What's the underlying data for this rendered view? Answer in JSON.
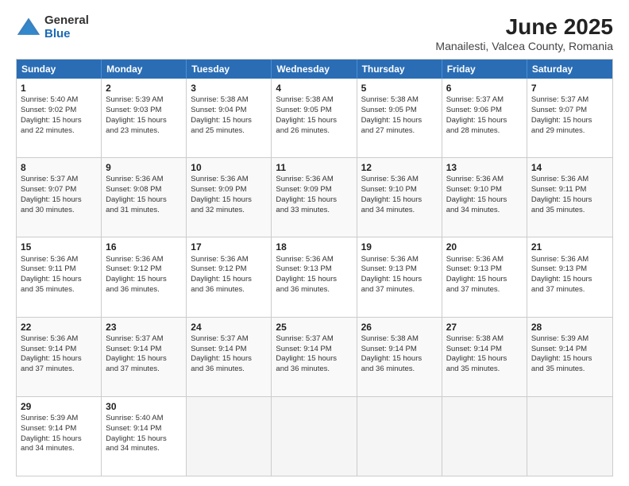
{
  "logo": {
    "general": "General",
    "blue": "Blue"
  },
  "title": "June 2025",
  "subtitle": "Manailesti, Valcea County, Romania",
  "header_days": [
    "Sunday",
    "Monday",
    "Tuesday",
    "Wednesday",
    "Thursday",
    "Friday",
    "Saturday"
  ],
  "weeks": [
    [
      {
        "day": "1",
        "lines": [
          "Sunrise: 5:40 AM",
          "Sunset: 9:02 PM",
          "Daylight: 15 hours",
          "and 22 minutes."
        ]
      },
      {
        "day": "2",
        "lines": [
          "Sunrise: 5:39 AM",
          "Sunset: 9:03 PM",
          "Daylight: 15 hours",
          "and 23 minutes."
        ]
      },
      {
        "day": "3",
        "lines": [
          "Sunrise: 5:38 AM",
          "Sunset: 9:04 PM",
          "Daylight: 15 hours",
          "and 25 minutes."
        ]
      },
      {
        "day": "4",
        "lines": [
          "Sunrise: 5:38 AM",
          "Sunset: 9:05 PM",
          "Daylight: 15 hours",
          "and 26 minutes."
        ]
      },
      {
        "day": "5",
        "lines": [
          "Sunrise: 5:38 AM",
          "Sunset: 9:05 PM",
          "Daylight: 15 hours",
          "and 27 minutes."
        ]
      },
      {
        "day": "6",
        "lines": [
          "Sunrise: 5:37 AM",
          "Sunset: 9:06 PM",
          "Daylight: 15 hours",
          "and 28 minutes."
        ]
      },
      {
        "day": "7",
        "lines": [
          "Sunrise: 5:37 AM",
          "Sunset: 9:07 PM",
          "Daylight: 15 hours",
          "and 29 minutes."
        ]
      }
    ],
    [
      {
        "day": "8",
        "lines": [
          "Sunrise: 5:37 AM",
          "Sunset: 9:07 PM",
          "Daylight: 15 hours",
          "and 30 minutes."
        ]
      },
      {
        "day": "9",
        "lines": [
          "Sunrise: 5:36 AM",
          "Sunset: 9:08 PM",
          "Daylight: 15 hours",
          "and 31 minutes."
        ]
      },
      {
        "day": "10",
        "lines": [
          "Sunrise: 5:36 AM",
          "Sunset: 9:09 PM",
          "Daylight: 15 hours",
          "and 32 minutes."
        ]
      },
      {
        "day": "11",
        "lines": [
          "Sunrise: 5:36 AM",
          "Sunset: 9:09 PM",
          "Daylight: 15 hours",
          "and 33 minutes."
        ]
      },
      {
        "day": "12",
        "lines": [
          "Sunrise: 5:36 AM",
          "Sunset: 9:10 PM",
          "Daylight: 15 hours",
          "and 34 minutes."
        ]
      },
      {
        "day": "13",
        "lines": [
          "Sunrise: 5:36 AM",
          "Sunset: 9:10 PM",
          "Daylight: 15 hours",
          "and 34 minutes."
        ]
      },
      {
        "day": "14",
        "lines": [
          "Sunrise: 5:36 AM",
          "Sunset: 9:11 PM",
          "Daylight: 15 hours",
          "and 35 minutes."
        ]
      }
    ],
    [
      {
        "day": "15",
        "lines": [
          "Sunrise: 5:36 AM",
          "Sunset: 9:11 PM",
          "Daylight: 15 hours",
          "and 35 minutes."
        ]
      },
      {
        "day": "16",
        "lines": [
          "Sunrise: 5:36 AM",
          "Sunset: 9:12 PM",
          "Daylight: 15 hours",
          "and 36 minutes."
        ]
      },
      {
        "day": "17",
        "lines": [
          "Sunrise: 5:36 AM",
          "Sunset: 9:12 PM",
          "Daylight: 15 hours",
          "and 36 minutes."
        ]
      },
      {
        "day": "18",
        "lines": [
          "Sunrise: 5:36 AM",
          "Sunset: 9:13 PM",
          "Daylight: 15 hours",
          "and 36 minutes."
        ]
      },
      {
        "day": "19",
        "lines": [
          "Sunrise: 5:36 AM",
          "Sunset: 9:13 PM",
          "Daylight: 15 hours",
          "and 37 minutes."
        ]
      },
      {
        "day": "20",
        "lines": [
          "Sunrise: 5:36 AM",
          "Sunset: 9:13 PM",
          "Daylight: 15 hours",
          "and 37 minutes."
        ]
      },
      {
        "day": "21",
        "lines": [
          "Sunrise: 5:36 AM",
          "Sunset: 9:13 PM",
          "Daylight: 15 hours",
          "and 37 minutes."
        ]
      }
    ],
    [
      {
        "day": "22",
        "lines": [
          "Sunrise: 5:36 AM",
          "Sunset: 9:14 PM",
          "Daylight: 15 hours",
          "and 37 minutes."
        ]
      },
      {
        "day": "23",
        "lines": [
          "Sunrise: 5:37 AM",
          "Sunset: 9:14 PM",
          "Daylight: 15 hours",
          "and 37 minutes."
        ]
      },
      {
        "day": "24",
        "lines": [
          "Sunrise: 5:37 AM",
          "Sunset: 9:14 PM",
          "Daylight: 15 hours",
          "and 36 minutes."
        ]
      },
      {
        "day": "25",
        "lines": [
          "Sunrise: 5:37 AM",
          "Sunset: 9:14 PM",
          "Daylight: 15 hours",
          "and 36 minutes."
        ]
      },
      {
        "day": "26",
        "lines": [
          "Sunrise: 5:38 AM",
          "Sunset: 9:14 PM",
          "Daylight: 15 hours",
          "and 36 minutes."
        ]
      },
      {
        "day": "27",
        "lines": [
          "Sunrise: 5:38 AM",
          "Sunset: 9:14 PM",
          "Daylight: 15 hours",
          "and 35 minutes."
        ]
      },
      {
        "day": "28",
        "lines": [
          "Sunrise: 5:39 AM",
          "Sunset: 9:14 PM",
          "Daylight: 15 hours",
          "and 35 minutes."
        ]
      }
    ],
    [
      {
        "day": "29",
        "lines": [
          "Sunrise: 5:39 AM",
          "Sunset: 9:14 PM",
          "Daylight: 15 hours",
          "and 34 minutes."
        ]
      },
      {
        "day": "30",
        "lines": [
          "Sunrise: 5:40 AM",
          "Sunset: 9:14 PM",
          "Daylight: 15 hours",
          "and 34 minutes."
        ]
      },
      {
        "day": "",
        "lines": [],
        "empty": true
      },
      {
        "day": "",
        "lines": [],
        "empty": true
      },
      {
        "day": "",
        "lines": [],
        "empty": true
      },
      {
        "day": "",
        "lines": [],
        "empty": true
      },
      {
        "day": "",
        "lines": [],
        "empty": true
      }
    ]
  ]
}
